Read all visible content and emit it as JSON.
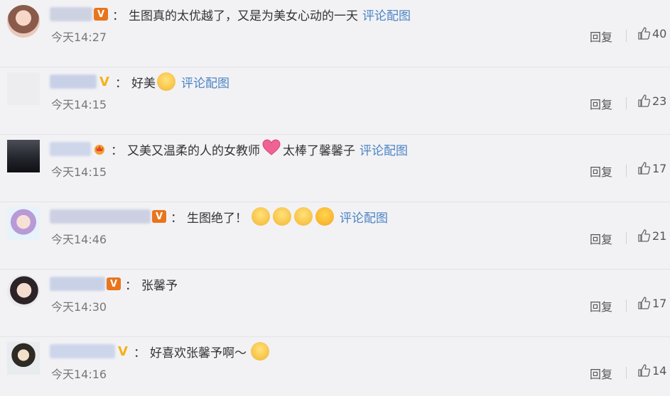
{
  "comments": [
    {
      "comment_text": "生图真的太优越了，又是为美女心动的一天",
      "link_label": "评论配图",
      "time": "今天14:27",
      "reply_label": "回复",
      "likes": "40"
    },
    {
      "comment_text": "好美",
      "link_label": "评论配图",
      "time": "今天14:15",
      "reply_label": "回复",
      "likes": "23"
    },
    {
      "comment_text_1": "又美又温柔的人的女教师",
      "comment_text_2": "太棒了馨馨子",
      "link_label": "评论配图",
      "time": "今天14:15",
      "reply_label": "回复",
      "likes": "17"
    },
    {
      "comment_text": "生图绝了！",
      "link_label": "评论配图",
      "time": "今天14:46",
      "reply_label": "回复",
      "likes": "21"
    },
    {
      "comment_text": "张馨予",
      "time": "今天14:30",
      "reply_label": "回复",
      "likes": "17"
    },
    {
      "comment_text": "好喜欢张馨予啊～",
      "time": "今天14:16",
      "reply_label": "回复",
      "likes": "14"
    }
  ],
  "badges": {
    "v_box": "V",
    "v_text": "V"
  },
  "colon": "：",
  "colors": {
    "link": "#4c84c3",
    "verified_orange": "#e8751b",
    "verified_gold": "#f2b318",
    "background": "#f2f2f5"
  },
  "icons": [
    "thumbs-up-icon",
    "verified-icon",
    "crown-icon",
    "emoji-icon"
  ]
}
